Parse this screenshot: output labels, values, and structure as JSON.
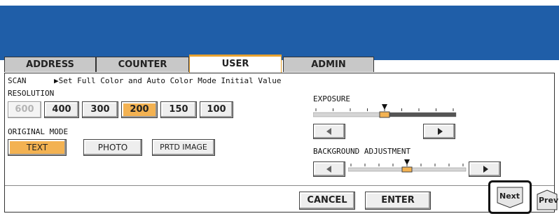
{
  "tabs": [
    {
      "label": "ADDRESS",
      "active": false
    },
    {
      "label": "COUNTER",
      "active": false
    },
    {
      "label": "USER",
      "active": true
    },
    {
      "label": "ADMIN",
      "active": false
    }
  ],
  "header": {
    "section": "SCAN",
    "instruction": "▶Set Full Color and Auto Color Mode Initial Value"
  },
  "resolution": {
    "label": "RESOLUTION",
    "options": [
      "600",
      "400",
      "300",
      "200",
      "150",
      "100"
    ],
    "selected": "200",
    "disabled": [
      "600"
    ]
  },
  "original_mode": {
    "label": "ORIGINAL MODE",
    "options": [
      "TEXT",
      "PHOTO",
      "PRTD IMAGE"
    ],
    "selected": "TEXT"
  },
  "exposure": {
    "label": "EXPOSURE",
    "level_fraction": 0.5,
    "left_icon": "decrease-icon",
    "right_icon": "increase-icon"
  },
  "background_adjustment": {
    "label": "BACKGROUND ADJUSTMENT",
    "level_fraction": 0.5,
    "left_icon": "decrease-icon",
    "right_icon": "increase-icon"
  },
  "footer": {
    "cancel_label": "CANCEL",
    "enter_label": "ENTER"
  },
  "pager": {
    "next_label": "Next",
    "prev_label": "Prev"
  },
  "colors": {
    "header_blue": "#1f5ea8",
    "selected": "#f3b252",
    "active_tab_accent": "#e8a230"
  }
}
